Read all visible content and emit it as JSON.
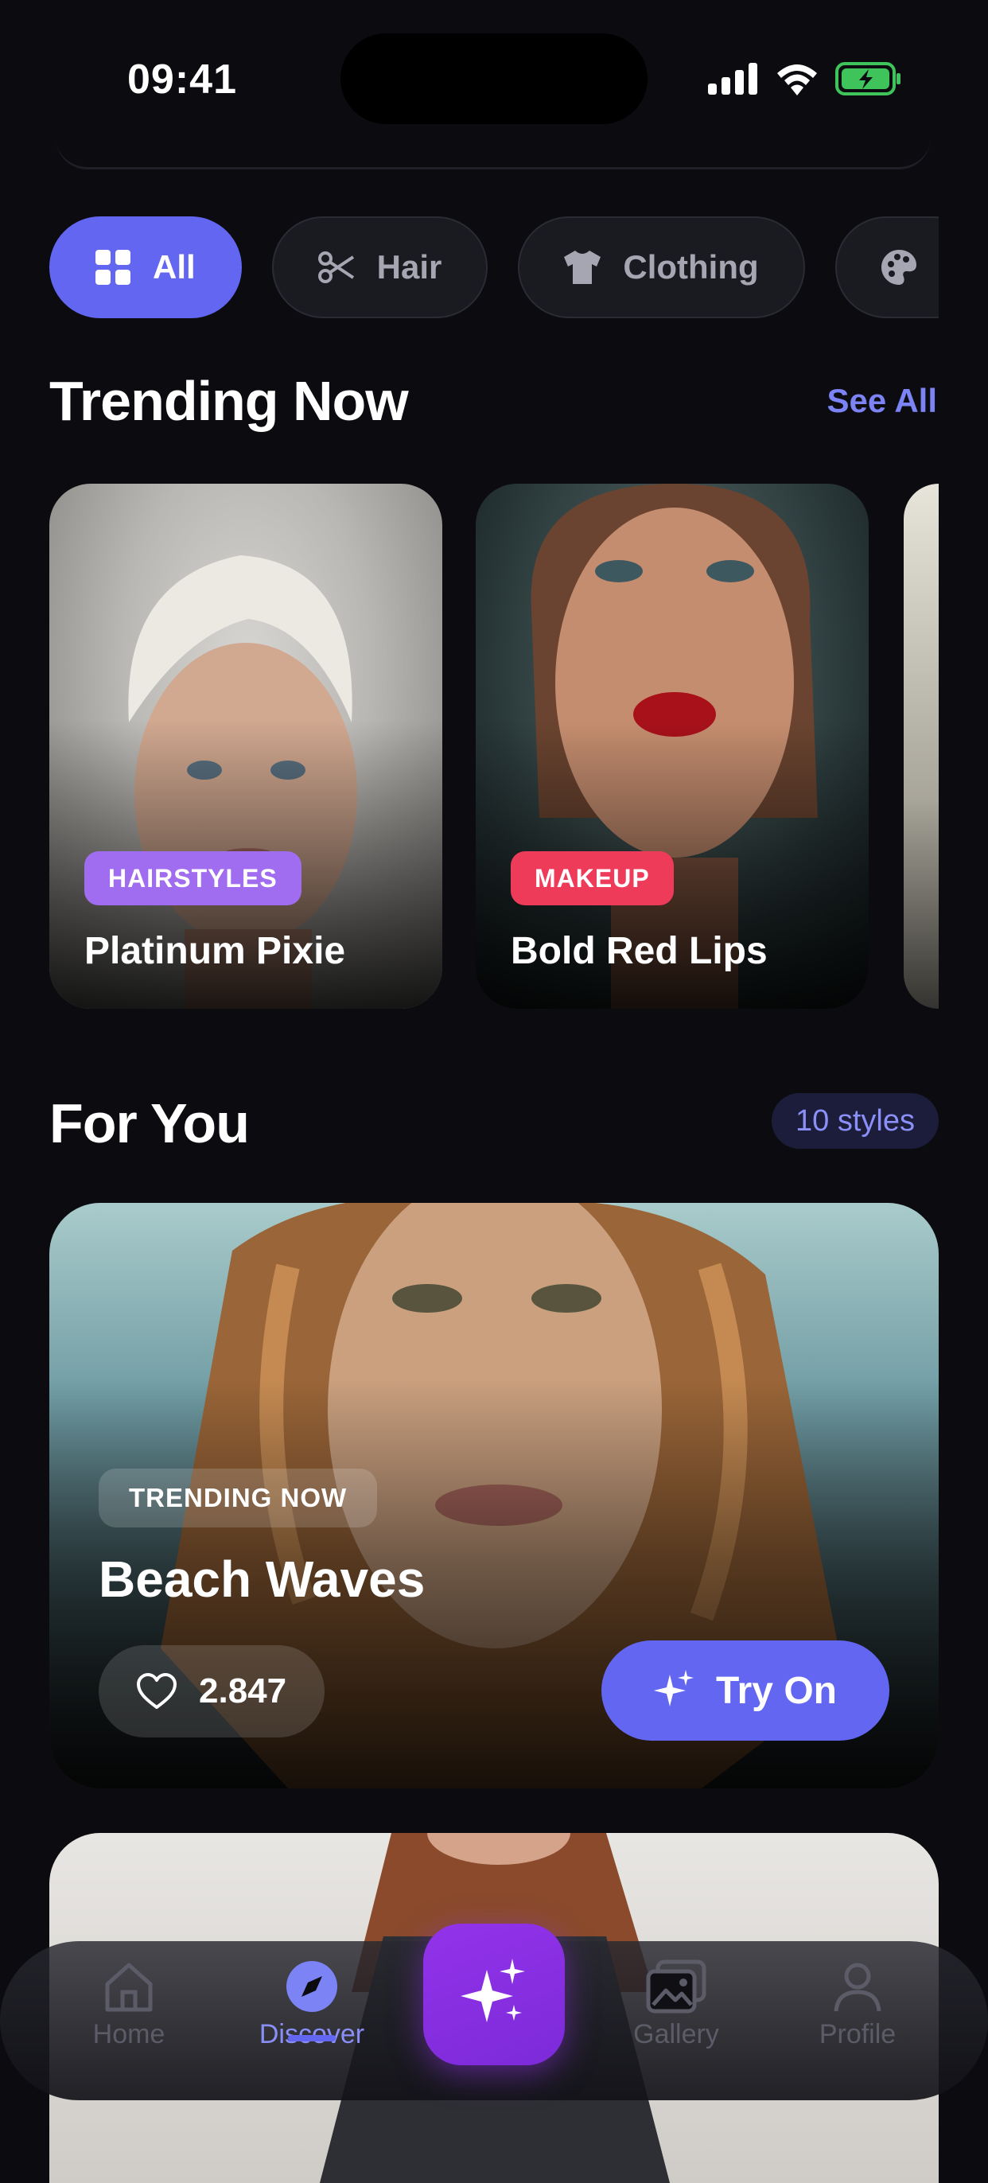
{
  "status_bar": {
    "time": "09:41"
  },
  "chips": [
    {
      "label": "All",
      "icon": "grid-icon",
      "active": true
    },
    {
      "label": "Hair",
      "icon": "scissors-icon",
      "active": false
    },
    {
      "label": "Clothing",
      "icon": "shirt-icon",
      "active": false
    },
    {
      "label": "",
      "icon": "palette-icon",
      "active": false
    }
  ],
  "trending": {
    "title": "Trending Now",
    "see_all": "See All",
    "cards": [
      {
        "badge": "HAIRSTYLES",
        "title": "Platinum Pixie",
        "badge_color": "#a06cf0"
      },
      {
        "badge": "MAKEUP",
        "title": "Bold Red Lips",
        "badge_color": "#ef3b5a"
      }
    ]
  },
  "for_you": {
    "title": "For You",
    "count": "10 styles",
    "card": {
      "tag": "TRENDING NOW",
      "title": "Beach Waves",
      "likes": "2.847",
      "cta": "Try On"
    }
  },
  "nav": {
    "items": [
      {
        "label": "Home",
        "icon": "home-icon"
      },
      {
        "label": "Discover",
        "icon": "compass-icon"
      },
      {
        "label": "Gallery",
        "icon": "gallery-icon"
      },
      {
        "label": "Profile",
        "icon": "profile-icon"
      }
    ],
    "fab_icon": "sparkle-icon"
  },
  "colors": {
    "accent": "#6366f1",
    "background": "#0b0b10",
    "fab": "#9333ea"
  }
}
